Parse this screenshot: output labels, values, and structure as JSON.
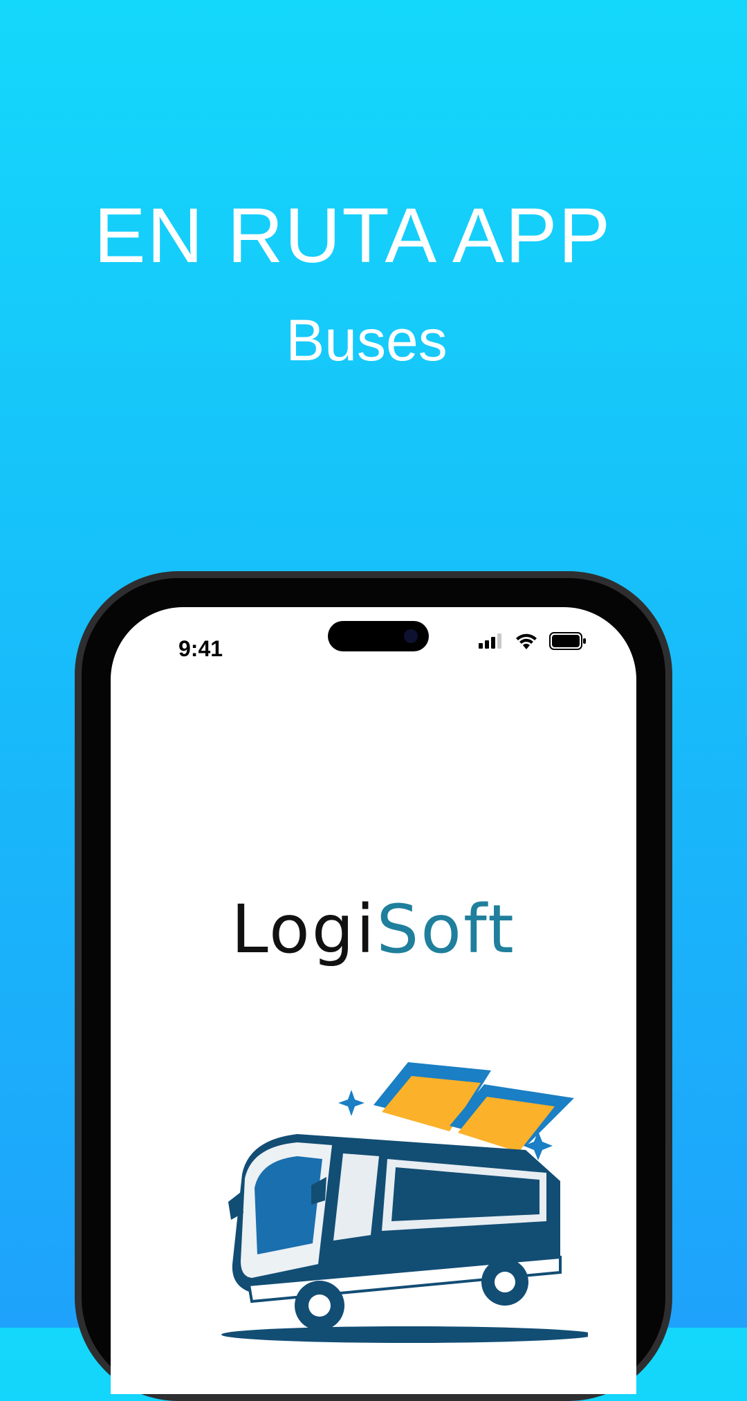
{
  "hero": {
    "title": "EN RUTA APP",
    "subtitle": "Buses"
  },
  "device": {
    "status_bar": {
      "time": "9:41"
    }
  },
  "app": {
    "logo_part1": "Logi",
    "logo_part2": "Soft",
    "illustration": "bus-with-tickets"
  },
  "colors": {
    "background_top": "#14d8fb",
    "background_bottom": "#1ea2fb",
    "logo_dark": "#111111",
    "logo_accent": "#1f7f9c",
    "bus_blue": "#124d74",
    "ticket_yellow": "#fbb12a"
  }
}
